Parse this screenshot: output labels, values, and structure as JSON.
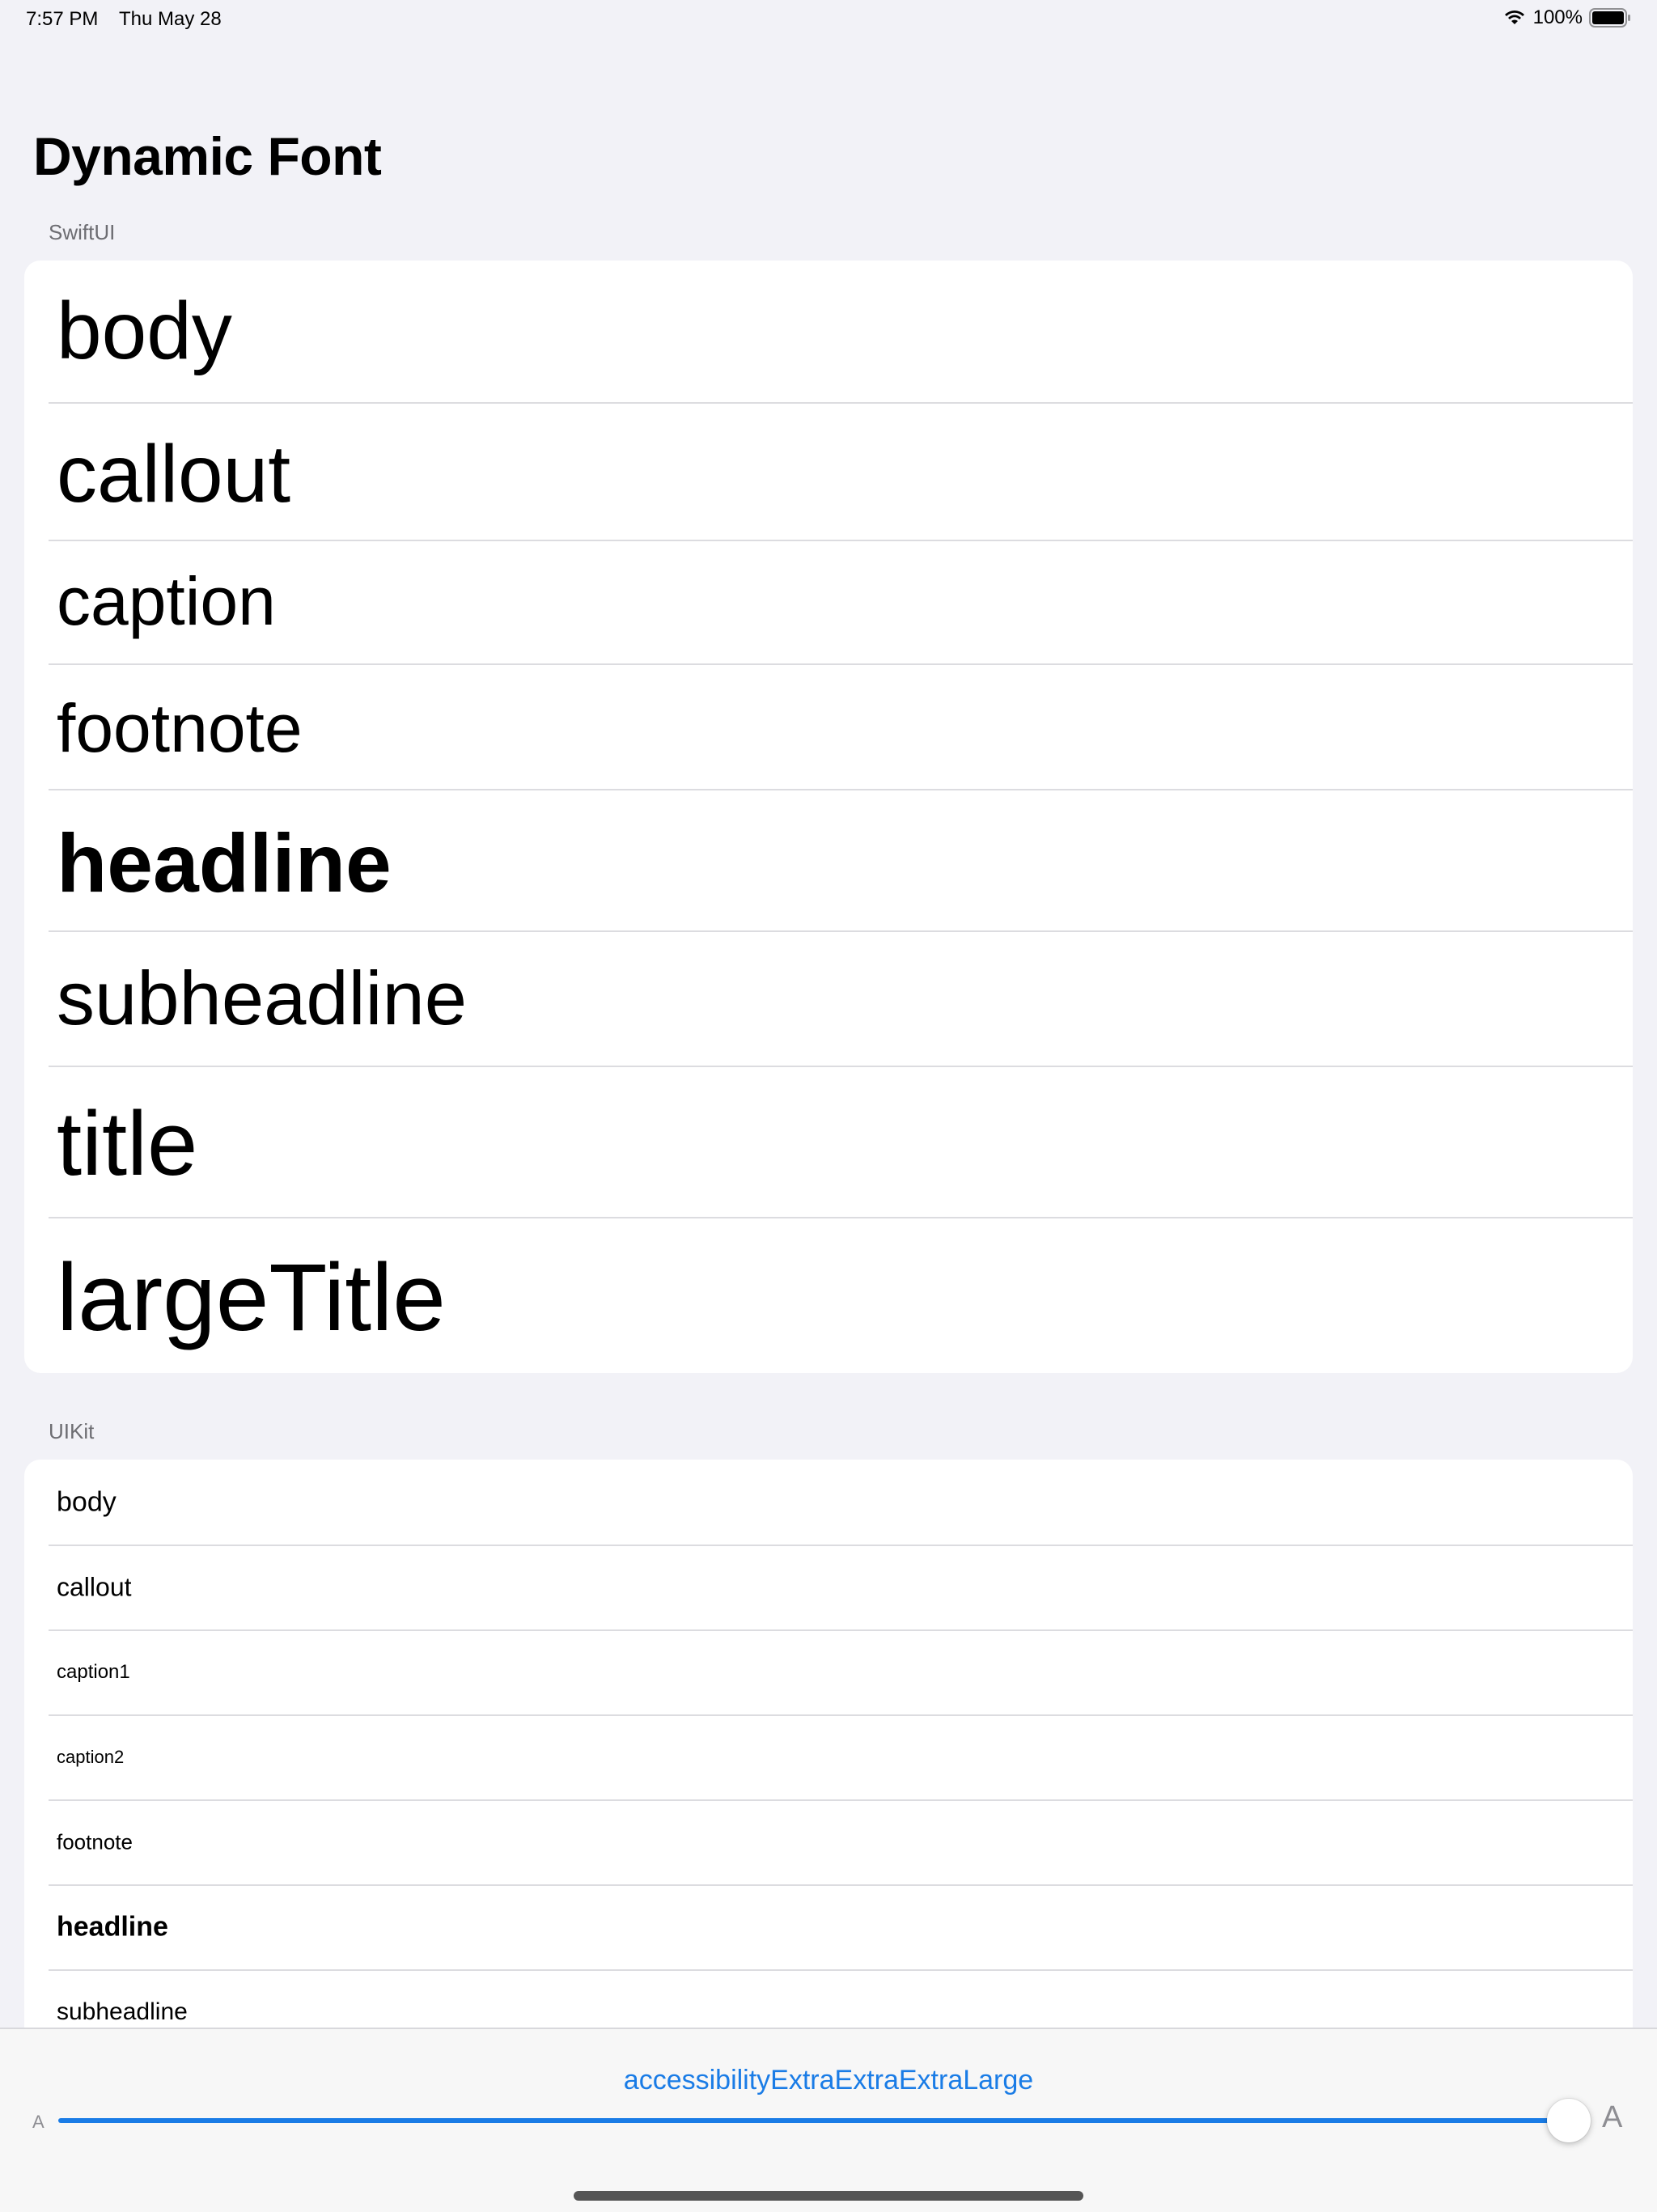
{
  "status_bar": {
    "time": "7:57 PM",
    "date": "Thu May 28",
    "battery_percent": "100%"
  },
  "title": "Dynamic Font",
  "sections": {
    "swiftui": {
      "header": "SwiftUI",
      "rows": [
        "body",
        "callout",
        "caption",
        "footnote",
        "headline",
        "subheadline",
        "title",
        "largeTitle"
      ]
    },
    "uikit": {
      "header": "UIKit",
      "rows": [
        "body",
        "callout",
        "caption1",
        "caption2",
        "footnote",
        "headline",
        "subheadline"
      ]
    }
  },
  "size_control": {
    "current_size": "accessibilityExtraExtraExtraLarge",
    "small_label": "A",
    "large_label": "A",
    "slider_value_fraction": 1.0
  },
  "colors": {
    "accent": "#1a7ce6",
    "background": "#f2f2f7",
    "card": "#ffffff",
    "separator": "#dcdce0"
  }
}
